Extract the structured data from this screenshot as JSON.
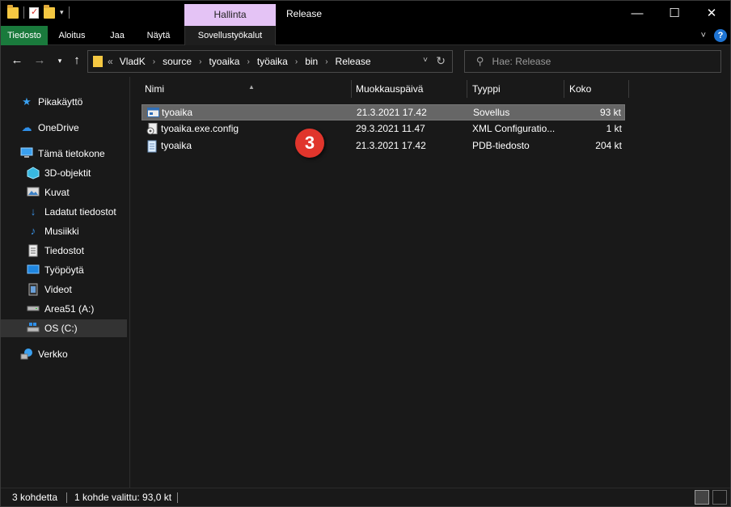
{
  "window": {
    "title": "Release",
    "context_tab": "Hallinta"
  },
  "ribbon": {
    "tabs": [
      "Tiedosto",
      "Aloitus",
      "Jaa",
      "Näytä",
      "Sovellustyökalut"
    ],
    "file_tab_color": "#1a7a3c",
    "context_tab_color": "#e4c3f5"
  },
  "address": {
    "overflow": "«",
    "crumbs": [
      "VladK",
      "source",
      "tyoaika",
      "työaika",
      "bin",
      "Release"
    ]
  },
  "search": {
    "placeholder": "Hae: Release"
  },
  "navpane": {
    "items": [
      {
        "label": "Pikakäyttö",
        "icon": "star-icon"
      },
      {
        "label": "OneDrive",
        "icon": "cloud-icon"
      },
      {
        "label": "Tämä tietokone",
        "icon": "computer-icon"
      },
      {
        "label": "3D-objektit",
        "icon": "cube-icon"
      },
      {
        "label": "Kuvat",
        "icon": "pictures-icon"
      },
      {
        "label": "Ladatut tiedostot",
        "icon": "download-icon"
      },
      {
        "label": "Musiikki",
        "icon": "music-icon"
      },
      {
        "label": "Tiedostot",
        "icon": "document-icon"
      },
      {
        "label": "Työpöytä",
        "icon": "desktop-icon"
      },
      {
        "label": "Videot",
        "icon": "video-icon"
      },
      {
        "label": "Area51 (A:)",
        "icon": "drive-icon"
      },
      {
        "label": "OS (C:)",
        "icon": "system-drive-icon"
      },
      {
        "label": "Verkko",
        "icon": "network-icon"
      }
    ]
  },
  "columns": [
    "Nimi",
    "Muokkauspäivä",
    "Tyyppi",
    "Koko"
  ],
  "files": [
    {
      "name": "tyoaika",
      "modified": "21.3.2021 17.42",
      "type": "Sovellus",
      "size": "93 kt",
      "icon": "application-icon"
    },
    {
      "name": "tyoaika.exe.config",
      "modified": "29.3.2021 11.47",
      "type": "XML Configuratio...",
      "size": "1 kt",
      "icon": "config-file-icon"
    },
    {
      "name": "tyoaika",
      "modified": "21.3.2021 17.42",
      "type": "PDB-tiedosto",
      "size": "204 kt",
      "icon": "pdb-file-icon"
    }
  ],
  "annotation": "3",
  "status": {
    "count": "3 kohdetta",
    "selection": "1 kohde valittu: 93,0 kt"
  }
}
